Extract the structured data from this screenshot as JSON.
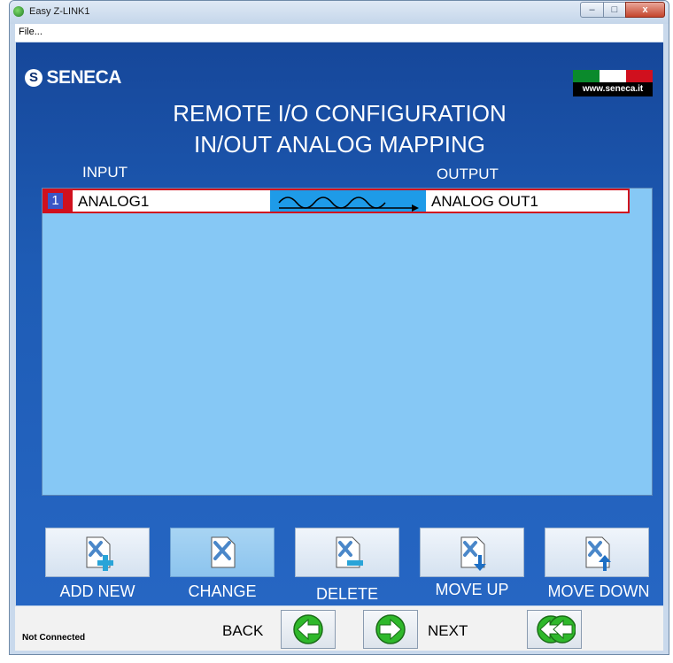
{
  "window": {
    "title": "Easy Z-LINK1",
    "controls": {
      "minimize": "–",
      "maximize": "□",
      "close": "x"
    }
  },
  "menu": {
    "file": "File..."
  },
  "brand": {
    "logo_text": "SENECA",
    "url": "www.seneca.it",
    "flag_colors": [
      "#0a8a2c",
      "#ffffff",
      "#d0101e"
    ]
  },
  "header": {
    "line1": "REMOTE I/O CONFIGURATION",
    "line2": "IN/OUT ANALOG MAPPING"
  },
  "columns": {
    "input": "INPUT",
    "output": "OUTPUT"
  },
  "mappings": [
    {
      "index": "1",
      "input": "ANALOG1",
      "output": "ANALOG OUT1"
    }
  ],
  "toolbar": {
    "add_new": "ADD NEW",
    "change": "CHANGE",
    "delete": "DELETE",
    "move_up": "MOVE UP",
    "move_down": "MOVE DOWN"
  },
  "status": {
    "connection": "Not Connected"
  },
  "nav": {
    "back": "BACK",
    "next": "NEXT"
  },
  "colors": {
    "background": "#1e5cb5",
    "list": "#86c8f5",
    "row_accent": "#d0101e",
    "nav_arrow": "#2fb82b"
  }
}
